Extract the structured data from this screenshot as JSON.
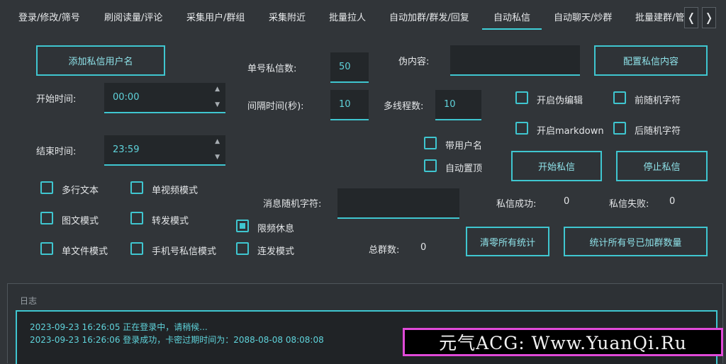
{
  "tabs": [
    {
      "label": "登录/修改/筛号"
    },
    {
      "label": "刷阅读量/评论"
    },
    {
      "label": "采集用户/群组"
    },
    {
      "label": "采集附近"
    },
    {
      "label": "批量拉人"
    },
    {
      "label": "自动加群/群发/回复"
    },
    {
      "label": "自动私信",
      "active": true
    },
    {
      "label": "自动聊天/炒群"
    },
    {
      "label": "批量建群/管"
    }
  ],
  "tab_nav": {
    "prev": "❬",
    "next": "❭"
  },
  "buttons": {
    "add_dm_user": "添加私信用户名",
    "config_dm": "配置私信内容",
    "start_dm": "开始私信",
    "stop_dm": "停止私信",
    "clear_stats": "清零所有统计",
    "count_groups": "统计所有号已加群数量"
  },
  "fields": {
    "start_time_label": "开始时间:",
    "start_time_value": "00:00",
    "end_time_label": "结束时间:",
    "end_time_value": "23:59",
    "per_account_label": "单号私信数:",
    "per_account_value": "50",
    "interval_label": "间隔时间(秒):",
    "interval_value": "10",
    "threads_label": "多线程数:",
    "threads_value": "10",
    "fake_content_label": "伪内容:",
    "msg_random_label": "消息随机字符:"
  },
  "checkboxes": {
    "multiline": {
      "label": "多行文本",
      "checked": false
    },
    "single_video": {
      "label": "单视频模式",
      "checked": false
    },
    "image_text": {
      "label": "图文模式",
      "checked": false
    },
    "forward": {
      "label": "转发模式",
      "checked": false
    },
    "single_file": {
      "label": "单文件模式",
      "checked": false
    },
    "phone_dm": {
      "label": "手机号私信模式",
      "checked": false
    },
    "limit_rest": {
      "label": "限频休息",
      "checked": true
    },
    "burst": {
      "label": "连发模式",
      "checked": false
    },
    "with_username": {
      "label": "带用户名",
      "checked": false
    },
    "auto_pin": {
      "label": "自动置顶",
      "checked": false
    },
    "fake_edit": {
      "label": "开启伪编辑",
      "checked": false
    },
    "pre_random": {
      "label": "前随机字符",
      "checked": false
    },
    "markdown": {
      "label": "开启markdown",
      "checked": false
    },
    "post_random": {
      "label": "后随机字符",
      "checked": false
    }
  },
  "stats": {
    "success_label": "私信成功:",
    "success_value": "0",
    "fail_label": "私信失败:",
    "fail_value": "0",
    "total_groups_label": "总群数:",
    "total_groups_value": "0"
  },
  "log": {
    "title": "日志",
    "lines": [
      "2023-09-23 16:26:05 正在登录中，请稍候...",
      "2023-09-23 16:26:06 登录成功，卡密过期时间为：2088-08-08 08:08:08"
    ]
  },
  "watermark": "元气ACG: Www.YuanQi.Ru",
  "colors": {
    "accent": "#3fc6d0",
    "background": "#313539",
    "watermark_border": "#e04ad8"
  }
}
